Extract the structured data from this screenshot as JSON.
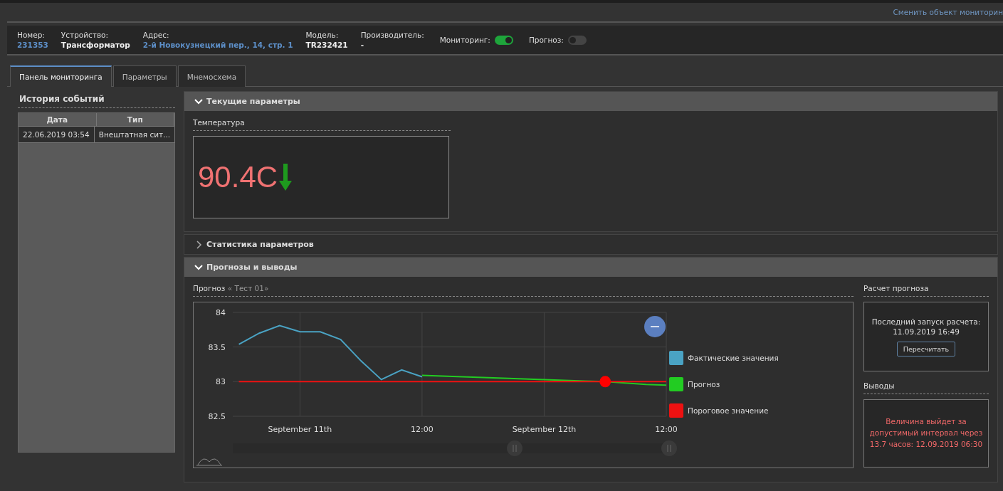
{
  "top_link": "Сменить объект мониторин",
  "info": [
    {
      "label": "Номер:",
      "value": "231353",
      "kind": "link"
    },
    {
      "label": "Устройство:",
      "value": "Трансформатор",
      "kind": "plain"
    },
    {
      "label": "Адрес:",
      "value": "2-й Новокузнецкий пер., 14, стр. 1",
      "kind": "link"
    },
    {
      "label": "Модель:",
      "value": "TR232421",
      "kind": "plain"
    },
    {
      "label": "Производитель:",
      "value": "-",
      "kind": "plain"
    }
  ],
  "toggles": [
    {
      "label": "Мониторинг:",
      "on": true
    },
    {
      "label": "Прогноз:",
      "on": false
    }
  ],
  "tabs": [
    {
      "label": "Панель мониторинга",
      "selected": true
    },
    {
      "label": "Параметры",
      "selected": false
    },
    {
      "label": "Мнемосхема",
      "selected": false
    }
  ],
  "history": {
    "title": "История событий",
    "columns": [
      "Дата",
      "Тип"
    ],
    "rows": [
      [
        "22.06.2019 03:54",
        "Внештатная сит..."
      ]
    ]
  },
  "sections": [
    {
      "title": "Текущие параметры",
      "expanded": true,
      "kind": "current",
      "param_label": "Температура",
      "value": "90.4C"
    },
    {
      "title": "Статистика параметров",
      "expanded": false
    },
    {
      "title": "Прогнозы и выводы",
      "expanded": true,
      "kind": "forecast"
    }
  ],
  "forecast": {
    "label": "Прогноз",
    "name": "« Тест 01»",
    "chart_data": {
      "type": "line",
      "categories": [
        null,
        null,
        null,
        "September 11th",
        null,
        null,
        null,
        null,
        null,
        "12:00",
        null,
        null,
        null,
        null,
        null,
        "September 12th",
        null,
        null,
        null,
        null,
        null,
        "12:00"
      ],
      "series": [
        {
          "name": "Фактические значения",
          "color": "#4aa3c4",
          "values": [
            83.54,
            83.7,
            83.81,
            83.72,
            83.72,
            83.61,
            83.3,
            83.03,
            83.17,
            83.07,
            null,
            null,
            null,
            null,
            null,
            null,
            null,
            null,
            null,
            null,
            null,
            null
          ]
        },
        {
          "name": "Прогноз",
          "color": "#22cc22",
          "values": [
            null,
            null,
            null,
            null,
            null,
            null,
            null,
            null,
            null,
            83.09,
            83.08,
            83.07,
            83.06,
            83.05,
            83.04,
            83.03,
            83.02,
            83.01,
            83.0,
            82.98,
            82.96,
            82.95
          ]
        },
        {
          "name": "Пороговое значение",
          "color": "#ee1111",
          "values": [
            83,
            83,
            83,
            83,
            83,
            83,
            83,
            83,
            83,
            83,
            83,
            83,
            83,
            83,
            83,
            83,
            83,
            83,
            83,
            83,
            83,
            83
          ]
        }
      ],
      "ylim": [
        82.5,
        84
      ],
      "grid": true,
      "yticks": [
        {
          "value": 82.5,
          "label": "82.5"
        },
        {
          "value": 83,
          "label": "83"
        },
        {
          "value": 83.5,
          "label": "83.5"
        },
        {
          "value": 84,
          "label": "84"
        }
      ]
    }
  },
  "calc": {
    "title": "Расчет прогноза",
    "text": "Последний запуск расчета:",
    "time": "11.09.2019 16:49",
    "button": "Пересчитать"
  },
  "conclusions": {
    "title": "Выводы",
    "text": "Величина выйдет за допустимый интервал через 13.7 часов: 12.09.2019 06:30"
  }
}
